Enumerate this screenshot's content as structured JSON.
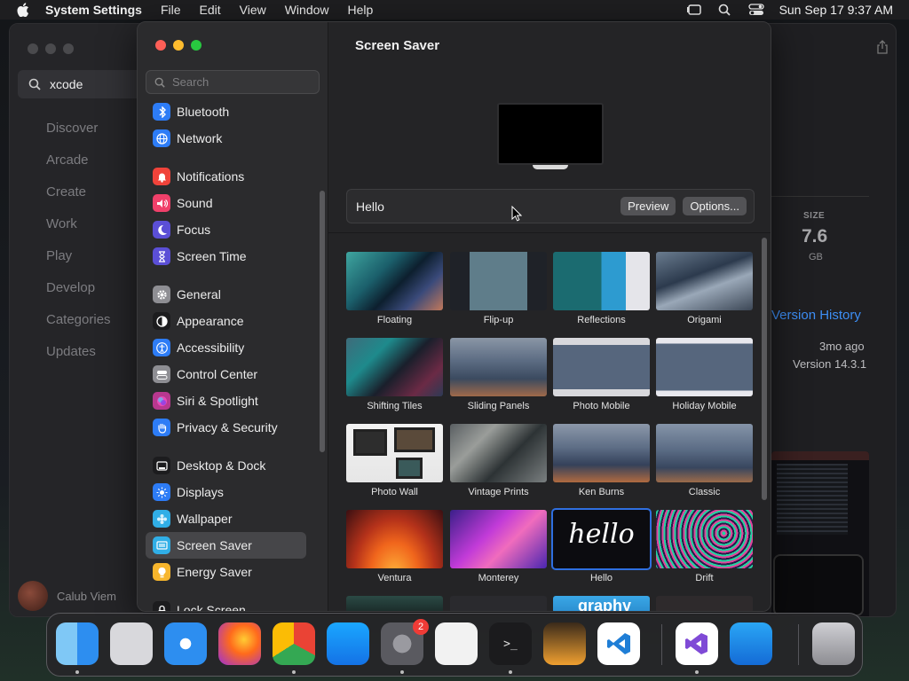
{
  "menubar": {
    "app": "System Settings",
    "menus": [
      "File",
      "Edit",
      "View",
      "Window",
      "Help"
    ],
    "clock": "Sun Sep 17  9:37 AM"
  },
  "appstore": {
    "search_value": "xcode",
    "nav": [
      "Discover",
      "Arcade",
      "Create",
      "Work",
      "Play",
      "Develop",
      "Categories",
      "Updates"
    ],
    "user": "Calub Viem",
    "size_label": "SIZE",
    "size_value": "7.6",
    "size_unit": "GB",
    "version_history": "Version History",
    "updated_ago": "3mo ago",
    "version": "Version 14.3.1"
  },
  "settings": {
    "search_placeholder": "Search",
    "sidebar": [
      {
        "label": "Bluetooth",
        "icon": "bluetooth-icon",
        "color": "#2d7cf6"
      },
      {
        "label": "Network",
        "icon": "globe-icon",
        "color": "#2d7cf6"
      },
      {
        "label": "Notifications",
        "icon": "bell-icon",
        "color": "#f0433a"
      },
      {
        "label": "Sound",
        "icon": "speaker-icon",
        "color": "#f0406a"
      },
      {
        "label": "Focus",
        "icon": "moon-icon",
        "color": "#5b4fd6"
      },
      {
        "label": "Screen Time",
        "icon": "hourglass-icon",
        "color": "#5b4fd6"
      },
      {
        "label": "General",
        "icon": "gear-icon",
        "color": "#8e8e93"
      },
      {
        "label": "Appearance",
        "icon": "appearance-icon",
        "color": "#1c1c1e"
      },
      {
        "label": "Accessibility",
        "icon": "accessibility-icon",
        "color": "#2d7cf6"
      },
      {
        "label": "Control Center",
        "icon": "toggles-icon",
        "color": "#8e8e93"
      },
      {
        "label": "Siri & Spotlight",
        "icon": "siri-icon",
        "color": "#b8388f"
      },
      {
        "label": "Privacy & Security",
        "icon": "hand-icon",
        "color": "#2d7cf6"
      },
      {
        "label": "Desktop & Dock",
        "icon": "dock-icon",
        "color": "#1c1c1e"
      },
      {
        "label": "Displays",
        "icon": "sun-icon",
        "color": "#2d7cf6"
      },
      {
        "label": "Wallpaper",
        "icon": "flower-icon",
        "color": "#30aee6"
      },
      {
        "label": "Screen Saver",
        "icon": "screen-saver-icon",
        "color": "#30aee6"
      },
      {
        "label": "Energy Saver",
        "icon": "bulb-icon",
        "color": "#f7b52c"
      },
      {
        "label": "Lock Screen",
        "icon": "lock-icon",
        "color": "#1c1c1e"
      }
    ],
    "selected": "Screen Saver",
    "page_title": "Screen Saver",
    "current_saver": "Hello",
    "preview_button": "Preview",
    "options_button": "Options...",
    "savers": [
      {
        "name": "Floating"
      },
      {
        "name": "Flip-up"
      },
      {
        "name": "Reflections"
      },
      {
        "name": "Origami"
      },
      {
        "name": "Shifting Tiles"
      },
      {
        "name": "Sliding Panels"
      },
      {
        "name": "Photo Mobile"
      },
      {
        "name": "Holiday Mobile"
      },
      {
        "name": "Photo Wall"
      },
      {
        "name": "Vintage Prints"
      },
      {
        "name": "Ken Burns"
      },
      {
        "name": "Classic"
      },
      {
        "name": "Ventura"
      },
      {
        "name": "Monterey"
      },
      {
        "name": "Hello"
      },
      {
        "name": "Drift"
      }
    ],
    "hello_thumb_text": "hello",
    "partial_row_text": "graphy"
  },
  "dock": {
    "items": [
      "Finder",
      "Launchpad",
      "Safari",
      "Firefox",
      "Chrome",
      "App Store",
      "System Settings",
      "TextEdit",
      "Terminal",
      "GarageBand",
      "Visual Studio Code",
      "Visual Studio",
      "Weather",
      "Trash"
    ],
    "settings_badge": "2"
  }
}
